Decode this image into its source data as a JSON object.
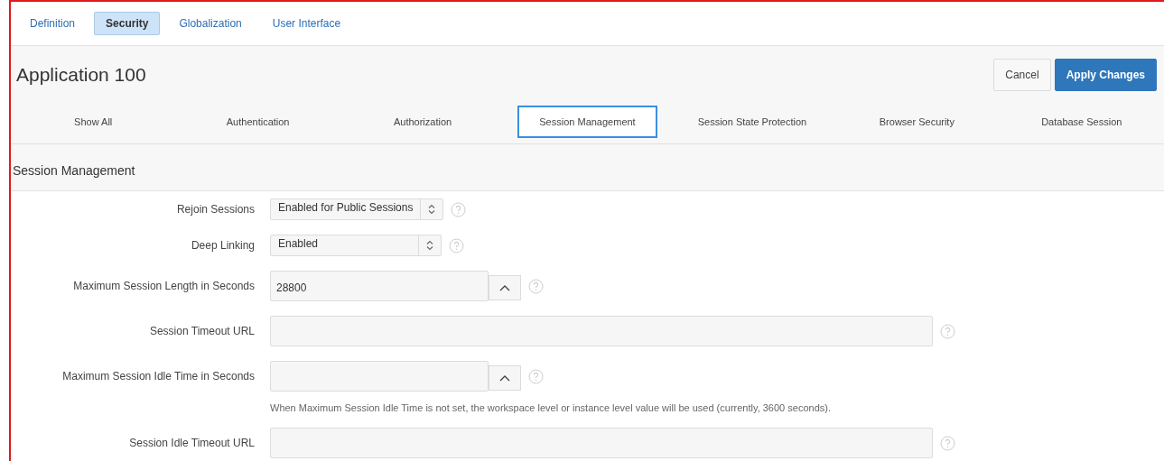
{
  "top_tabs": [
    {
      "label": "Definition",
      "selected": false
    },
    {
      "label": "Security",
      "selected": true
    },
    {
      "label": "Globalization",
      "selected": false
    },
    {
      "label": "User Interface",
      "selected": false
    }
  ],
  "page_title": "Application 100",
  "buttons": [
    {
      "label": "Cancel",
      "kind": "secondary"
    },
    {
      "label": "Apply Changes",
      "kind": "primary"
    }
  ],
  "region_tabs": [
    {
      "label": "Show All",
      "selected": false
    },
    {
      "label": "Authentication",
      "selected": false
    },
    {
      "label": "Authorization",
      "selected": false
    },
    {
      "label": "Session Management",
      "selected": true
    },
    {
      "label": "Session State Protection",
      "selected": false
    },
    {
      "label": "Browser Security",
      "selected": false
    },
    {
      "label": "Database Session",
      "selected": false
    }
  ],
  "section": {
    "title": "Session Management",
    "fields": [
      {
        "kind": "select",
        "label": "Rejoin Sessions",
        "value": "Enabled for Public Sessions"
      },
      {
        "kind": "select",
        "label": "Deep Linking",
        "value": "Enabled"
      },
      {
        "kind": "number",
        "label": "Maximum Session Length in Seconds",
        "value": "28800"
      },
      {
        "kind": "text",
        "label": "Session Timeout URL"
      },
      {
        "kind": "number",
        "label": "Maximum Session Idle Time in Seconds",
        "note": "When Maximum Session Idle Time is not set, the workspace level or instance level value will be used (currently, 3600 seconds)."
      },
      {
        "kind": "text",
        "label": "Session Idle Timeout URL"
      }
    ]
  }
}
